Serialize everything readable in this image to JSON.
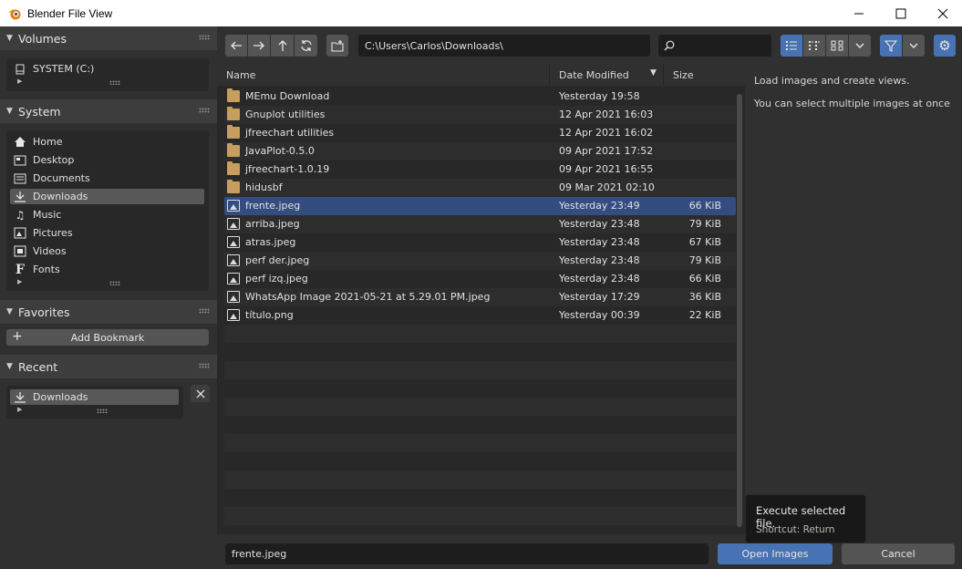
{
  "window": {
    "title": "Blender File View",
    "min_icon": "minimize-icon",
    "max_icon": "maximize-icon",
    "close_icon": "close-icon"
  },
  "sidebar": {
    "volumes": {
      "title": "Volumes",
      "items": [
        {
          "label": "SYSTEM (C:)",
          "icon": "drive-icon"
        }
      ]
    },
    "system": {
      "title": "System",
      "items": [
        {
          "label": "Home",
          "icon": "home-icon"
        },
        {
          "label": "Desktop",
          "icon": "desktop-icon"
        },
        {
          "label": "Documents",
          "icon": "documents-icon"
        },
        {
          "label": "Downloads",
          "icon": "downloads-icon",
          "selected": true
        },
        {
          "label": "Music",
          "icon": "music-icon"
        },
        {
          "label": "Pictures",
          "icon": "pictures-icon"
        },
        {
          "label": "Videos",
          "icon": "videos-icon"
        },
        {
          "label": "Fonts",
          "icon": "fonts-icon"
        }
      ]
    },
    "favorites": {
      "title": "Favorites",
      "add_label": "Add Bookmark"
    },
    "recent": {
      "title": "Recent",
      "items": [
        {
          "label": "Downloads",
          "icon": "downloads-icon"
        }
      ]
    }
  },
  "toolbar": {
    "path": "C:\\Users\\Carlos\\Downloads\\",
    "search_value": ""
  },
  "columns": {
    "name": "Name",
    "date": "Date Modified",
    "size": "Size"
  },
  "files": [
    {
      "name": "MEmu Download",
      "date": "Yesterday 19:58",
      "size": "",
      "type": "folder"
    },
    {
      "name": "Gnuplot utilities",
      "date": "12 Apr 2021 16:03",
      "size": "",
      "type": "folder"
    },
    {
      "name": "jfreechart utilities",
      "date": "12 Apr 2021 16:02",
      "size": "",
      "type": "folder"
    },
    {
      "name": "JavaPlot-0.5.0",
      "date": "09 Apr 2021 17:52",
      "size": "",
      "type": "folder"
    },
    {
      "name": "jfreechart-1.0.19",
      "date": "09 Apr 2021 16:55",
      "size": "",
      "type": "folder"
    },
    {
      "name": "hidusbf",
      "date": "09 Mar 2021 02:10",
      "size": "",
      "type": "folder"
    },
    {
      "name": "frente.jpeg",
      "date": "Yesterday 23:49",
      "size": "66 KiB",
      "type": "image",
      "selected": true
    },
    {
      "name": "arriba.jpeg",
      "date": "Yesterday 23:48",
      "size": "79 KiB",
      "type": "image"
    },
    {
      "name": "atras.jpeg",
      "date": "Yesterday 23:48",
      "size": "67 KiB",
      "type": "image"
    },
    {
      "name": "perf der.jpeg",
      "date": "Yesterday 23:48",
      "size": "79 KiB",
      "type": "image"
    },
    {
      "name": "perf izq.jpeg",
      "date": "Yesterday 23:48",
      "size": "66 KiB",
      "type": "image"
    },
    {
      "name": "WhatsApp Image 2021-05-21 at 5.29.01 PM.jpeg",
      "date": "Yesterday 17:29",
      "size": "36 KiB",
      "type": "image"
    },
    {
      "name": "título.png",
      "date": "Yesterday 00:39",
      "size": "22 KiB",
      "type": "image"
    }
  ],
  "info": {
    "line1": "Load images and create views.",
    "line2": "You can select multiple images at once"
  },
  "tooltip": {
    "title": "Execute selected file.",
    "shortcut": "Shortcut: Return"
  },
  "bottom": {
    "filename": "frente.jpeg",
    "open_label": "Open Images",
    "cancel_label": "Cancel"
  },
  "colors": {
    "accent": "#4772b3",
    "selection": "#334d80"
  }
}
